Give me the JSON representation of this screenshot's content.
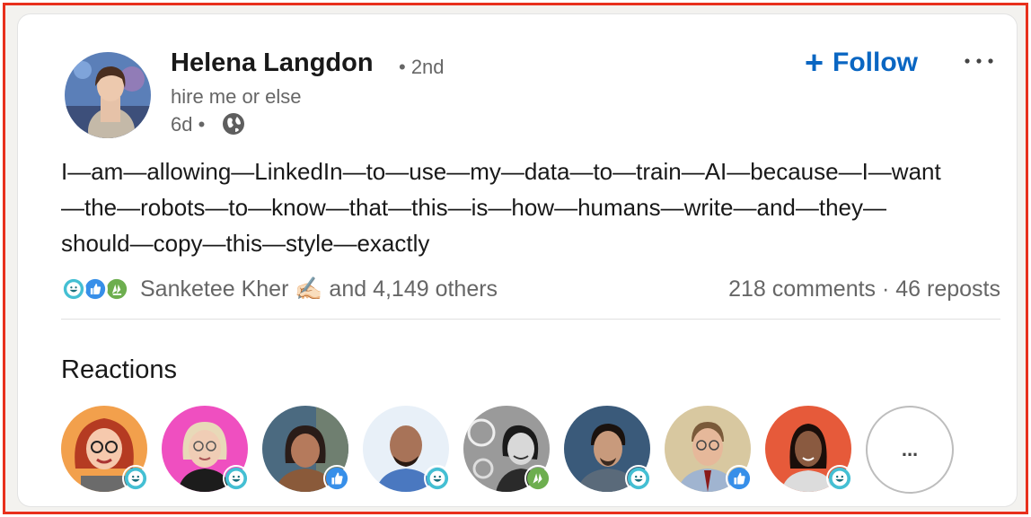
{
  "post": {
    "author": {
      "name": "Helena Langdon",
      "degree": "• 2nd",
      "headline": "hire me or else",
      "time": "6d •"
    },
    "follow_label": "Follow",
    "more_label": "•••",
    "text_lines": [
      "I—am—allowing—LinkedIn—to—use—my—data—to—train—AI—because—I—want",
      "—the—robots—to—know—that—this—is—how—humans—write—and—they—",
      "should—copy—this—style—exactly"
    ],
    "social": {
      "reactors_text": "Sanketee Kher ✍🏻 and 4,149 others",
      "counts_text": "218 comments · 46 reposts",
      "reaction_types": [
        "funny",
        "like",
        "celebrate"
      ]
    }
  },
  "reactions": {
    "heading": "Reactions",
    "reactors": [
      {
        "reaction": "funny"
      },
      {
        "reaction": "funny"
      },
      {
        "reaction": "like"
      },
      {
        "reaction": "funny"
      },
      {
        "reaction": "celebrate"
      },
      {
        "reaction": "funny"
      },
      {
        "reaction": "like"
      },
      {
        "reaction": "funny"
      }
    ],
    "see_more_label": "..."
  },
  "colors": {
    "accent": "#0a66c2",
    "frame": "#e8301c",
    "like": "#378fe9",
    "funny": "#44bfd3",
    "celebrate": "#6dae4f"
  }
}
